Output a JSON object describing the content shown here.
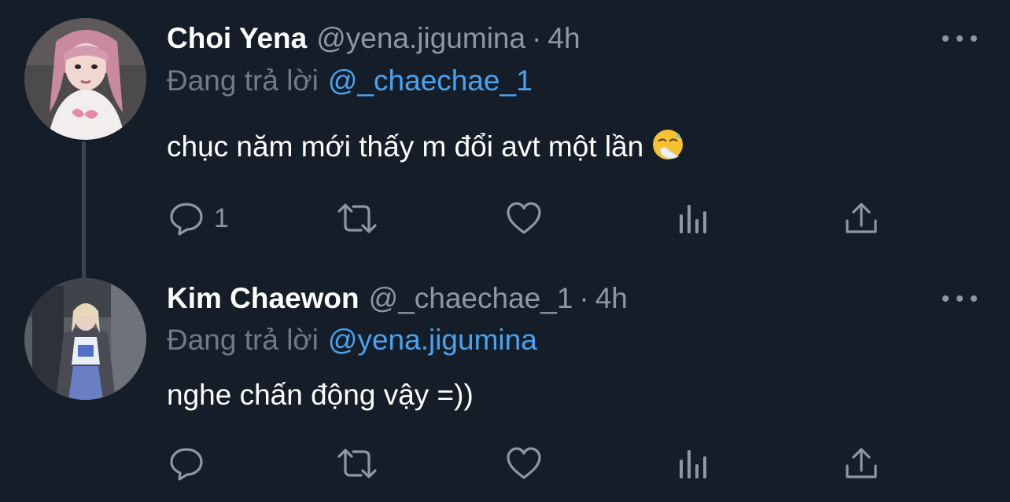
{
  "tweets": [
    {
      "display_name": "Choi Yena",
      "handle": "@yena.jigumina",
      "separator": "·",
      "time": "4h",
      "reply_prefix": "Đang trả lời",
      "reply_to": "@_chaechae_1",
      "text": "chục năm mới thấy m đổi avt một lần",
      "emoji": "sneezing-face-icon",
      "reply_count": "1",
      "avatar_colors": [
        "#c98aa0",
        "#f1e2e4"
      ]
    },
    {
      "display_name": "Kim Chaewon",
      "handle": "@_chaechae_1",
      "separator": "·",
      "time": "4h",
      "reply_prefix": "Đang trả lời",
      "reply_to": "@yena.jigumina",
      "text": "nghe chấn động vậy =))",
      "reply_count": "",
      "avatar_colors": [
        "#5a5f66",
        "#6a7fc4"
      ]
    }
  ],
  "actions": {
    "reply_icon": "reply-icon",
    "retweet_icon": "retweet-icon",
    "like_icon": "like-icon",
    "analytics_icon": "analytics-icon",
    "share_icon": "share-icon",
    "more_icon": "more-icon"
  },
  "colors": {
    "background": "#151d28",
    "secondary_text": "#8b98a5",
    "link": "#4aa3f0",
    "thread_line": "#3a444f"
  }
}
